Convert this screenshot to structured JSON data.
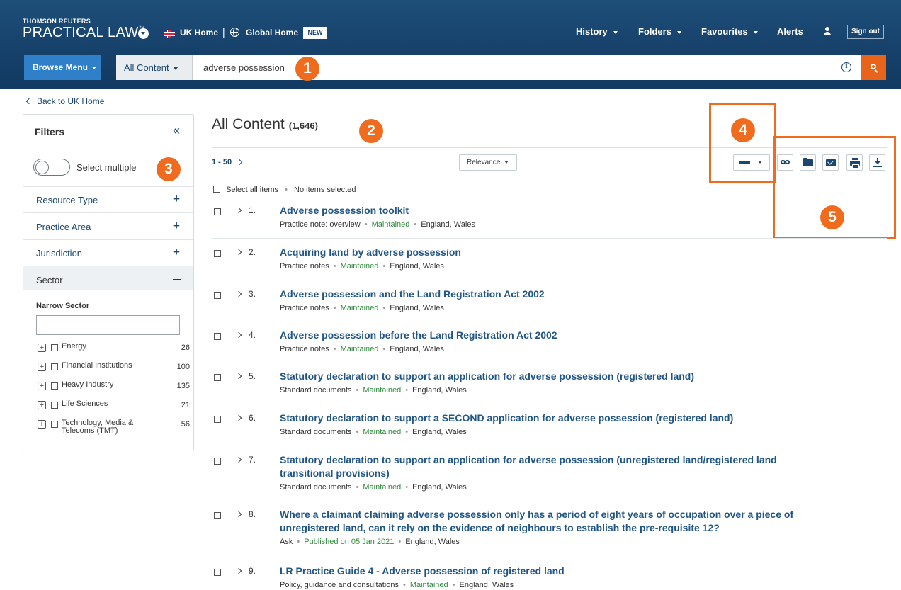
{
  "header": {
    "brand_small": "THOMSON REUTERS",
    "brand_big": "PRACTICAL LAW",
    "brand_tm": "™",
    "uk_home": "UK Home",
    "separator": "|",
    "global_home": "Global Home",
    "new_badge": "NEW",
    "nav": [
      "History",
      "Folders",
      "Favourites",
      "Alerts"
    ],
    "sign_out": "Sign out"
  },
  "search": {
    "browse_menu": "Browse Menu",
    "scope": "All Content",
    "query": "adverse possession",
    "info_symbol": "i"
  },
  "annotations": [
    "1",
    "2",
    "3",
    "4",
    "5"
  ],
  "back_link": "Back to UK Home",
  "filters": {
    "title": "Filters",
    "collapse_symbol": "«",
    "select_multiple": "Select multiple",
    "facets": [
      "Resource Type",
      "Practice Area",
      "Jurisdiction"
    ],
    "plus_symbol": "+",
    "sector": "Sector",
    "narrow_sector": "Narrow Sector",
    "sector_items": [
      {
        "name": "Energy",
        "count": "26"
      },
      {
        "name": "Financial Institutions",
        "count": "100"
      },
      {
        "name": "Heavy Industry",
        "count": "135"
      },
      {
        "name": "Life Sciences",
        "count": "21"
      },
      {
        "name": "Technology, Media & Telecoms (TMT)",
        "count": "56"
      }
    ]
  },
  "results": {
    "heading": "All Content",
    "count": "(1,646)",
    "paging": "1 - 50",
    "sort": "Relevance",
    "select_all": "Select all items",
    "no_items": "No items selected",
    "items": [
      {
        "num": "1.",
        "title": "Adverse possession toolkit",
        "type": "Practice note: overview",
        "status": "Maintained",
        "jurisdiction": "England, Wales"
      },
      {
        "num": "2.",
        "title": "Acquiring land by adverse possession",
        "type": "Practice notes",
        "status": "Maintained",
        "jurisdiction": "England, Wales"
      },
      {
        "num": "3.",
        "title": "Adverse possession and the Land Registration Act 2002",
        "type": "Practice notes",
        "status": "Maintained",
        "jurisdiction": "England, Wales"
      },
      {
        "num": "4.",
        "title": "Adverse possession before the Land Registration Act 2002",
        "type": "Practice notes",
        "status": "Maintained",
        "jurisdiction": "England, Wales"
      },
      {
        "num": "5.",
        "title": "Statutory declaration to support an application for adverse possession (registered land)",
        "type": "Standard documents",
        "status": "Maintained",
        "jurisdiction": "England, Wales"
      },
      {
        "num": "6.",
        "title": "Statutory declaration to support a SECOND application for adverse possession (registered land)",
        "type": "Standard documents",
        "status": "Maintained",
        "jurisdiction": "England, Wales"
      },
      {
        "num": "7.",
        "title": "Statutory declaration to support an application for adverse possession (unregistered land/registered land transitional provisions)",
        "type": "Standard documents",
        "status": "Maintained",
        "jurisdiction": "England, Wales"
      },
      {
        "num": "8.",
        "title": "Where a claimant claiming adverse possession only has a period of eight years of occupation over a piece of unregistered land, can it rely on the evidence of neighbours to establish the pre-requisite 12?",
        "type": "Ask",
        "status": "Published on 05 Jan 2021",
        "jurisdiction": "England, Wales"
      },
      {
        "num": "9.",
        "title": "LR Practice Guide 4 - Adverse possession of registered land",
        "type": "Policy, guidance and consultations",
        "status": "Maintained",
        "jurisdiction": "England, Wales"
      }
    ]
  },
  "colors": {
    "header": "#16406a",
    "accent": "#e8641b",
    "annotation": "#ef6c1e",
    "link": "#1f5587",
    "status": "#2e8b3d"
  },
  "icons": [
    "chevron-down-icon",
    "uk-flag-icon",
    "globe-icon",
    "user-icon",
    "info-icon",
    "search-icon",
    "chevron-left-icon",
    "collapse-icon",
    "link-icon",
    "folder-icon",
    "mail-icon",
    "print-icon",
    "download-icon"
  ]
}
